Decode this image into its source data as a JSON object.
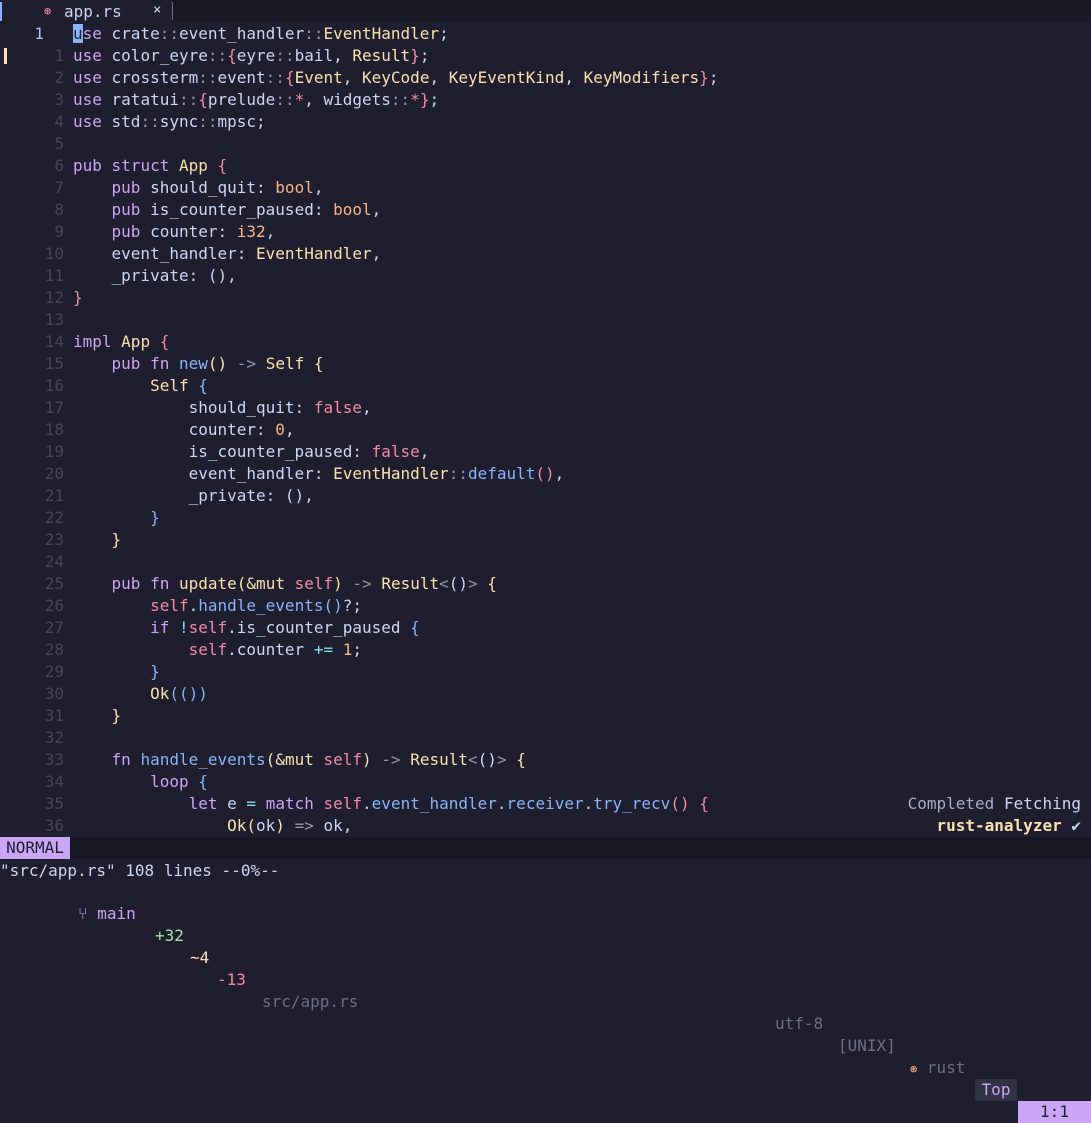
{
  "tab": {
    "file_icon": "rust-icon",
    "filename": "app.rs",
    "close": "×"
  },
  "lines": [
    {
      "num": "1",
      "current": true,
      "sign": false,
      "html": "<span class=\"cursor\">u</span><span class=\"kw\">se</span> crate<span class=\"pu\">::</span>event_handler<span class=\"pu\">::</span><span class=\"ty\">EventHandler</span>;"
    },
    {
      "num": "1",
      "current": false,
      "sign": true,
      "html": "<span class=\"kw\">use</span> color_eyre<span class=\"pu\">::</span><span class=\"br1\">{</span>eyre<span class=\"pu\">::</span>bail, <span class=\"ty\">Result</span><span class=\"br1\">}</span>;"
    },
    {
      "num": "2",
      "current": false,
      "sign": false,
      "html": "<span class=\"kw\">use</span> crossterm<span class=\"pu\">::</span>event<span class=\"pu\">::</span><span class=\"br1\">{</span><span class=\"ty\">Event</span>, <span class=\"ty\">KeyCode</span>, <span class=\"ty\">KeyEventKind</span>, <span class=\"ty\">KeyModifiers</span><span class=\"br1\">}</span>;"
    },
    {
      "num": "3",
      "current": false,
      "sign": false,
      "html": "<span class=\"kw\">use</span> ratatui<span class=\"pu\">::</span><span class=\"br1\">{</span>prelude<span class=\"pu\">::</span><span class=\"br1\">*</span>, widgets<span class=\"pu\">::</span><span class=\"br1\">*</span><span class=\"br1\">}</span>;"
    },
    {
      "num": "4",
      "current": false,
      "sign": false,
      "html": "<span class=\"kw\">use</span> std<span class=\"pu\">::</span>sync<span class=\"pu\">::</span>mpsc;"
    },
    {
      "num": "5",
      "current": false,
      "sign": false,
      "html": ""
    },
    {
      "num": "6",
      "current": false,
      "sign": false,
      "html": "<span class=\"kw\">pub</span> <span class=\"kw\">struct</span> <span class=\"ty\">App</span> <span class=\"br1\">{</span>"
    },
    {
      "num": "7",
      "current": false,
      "sign": false,
      "html": "    <span class=\"kw\">pub</span> should_quit: <span class=\"nu\">bool</span>,"
    },
    {
      "num": "8",
      "current": false,
      "sign": false,
      "html": "    <span class=\"kw\">pub</span> is_counter_paused: <span class=\"nu\">bool</span>,"
    },
    {
      "num": "9",
      "current": false,
      "sign": false,
      "html": "    <span class=\"kw\">pub</span> counter: <span class=\"nu\">i32</span>,"
    },
    {
      "num": "10",
      "current": false,
      "sign": false,
      "html": "    event_handler: <span class=\"ty\">EventHandler</span>,"
    },
    {
      "num": "11",
      "current": false,
      "sign": false,
      "html": "    _private: (),"
    },
    {
      "num": "12",
      "current": false,
      "sign": false,
      "html": "<span class=\"br1\">}</span>"
    },
    {
      "num": "13",
      "current": false,
      "sign": false,
      "html": ""
    },
    {
      "num": "14",
      "current": false,
      "sign": false,
      "html": "<span class=\"kw\">impl</span> <span class=\"ty\">App</span> <span class=\"br1\">{</span>"
    },
    {
      "num": "15",
      "current": false,
      "sign": false,
      "html": "    <span class=\"kw\">pub</span> <span class=\"kw\">fn</span> <span class=\"fn\">new</span><span class=\"br2\">()</span> <span class=\"pu\">-&gt;</span> <span class=\"ty\">Self</span> <span class=\"br2\">{</span>"
    },
    {
      "num": "16",
      "current": false,
      "sign": false,
      "html": "        <span class=\"ty\">Self</span> <span class=\"br3\">{</span>"
    },
    {
      "num": "17",
      "current": false,
      "sign": false,
      "html": "            should_quit: <span class=\"sf\">false</span>,"
    },
    {
      "num": "18",
      "current": false,
      "sign": false,
      "html": "            counter: <span class=\"nu\">0</span>,"
    },
    {
      "num": "19",
      "current": false,
      "sign": false,
      "html": "            is_counter_paused: <span class=\"sf\">false</span>,"
    },
    {
      "num": "20",
      "current": false,
      "sign": false,
      "html": "            event_handler: <span class=\"ty\">EventHandler</span><span class=\"pu\">::</span><span class=\"fn\">default</span><span class=\"br1\">()</span>,"
    },
    {
      "num": "21",
      "current": false,
      "sign": false,
      "html": "            _private: (),"
    },
    {
      "num": "22",
      "current": false,
      "sign": false,
      "html": "        <span class=\"br3\">}</span>"
    },
    {
      "num": "23",
      "current": false,
      "sign": false,
      "html": "    <span class=\"br2\">}</span>"
    },
    {
      "num": "24",
      "current": false,
      "sign": false,
      "html": ""
    },
    {
      "num": "25",
      "current": false,
      "sign": false,
      "html": "    <span class=\"kw\">pub</span> <span class=\"kw\">fn</span> <span class=\"ty\">update</span><span class=\"br2\">(</span><span class=\"ty\">&amp;mut</span> <span class=\"sf\">self</span><span class=\"br2\">)</span> <span class=\"pu\">-&gt;</span> <span class=\"ty\">Result</span><span class=\"pu\">&lt;</span>()<span class=\"pu\">&gt;</span> <span class=\"br2\">{</span>"
    },
    {
      "num": "26",
      "current": false,
      "sign": false,
      "html": "        <span class=\"sf\">self</span>.<span class=\"fn\">handle_events</span><span class=\"br3\">()</span>?;"
    },
    {
      "num": "27",
      "current": false,
      "sign": false,
      "html": "        <span class=\"kw\">if</span> <span class=\"op\">!</span><span class=\"sf\">self</span>.is_counter_paused <span class=\"br3\">{</span>"
    },
    {
      "num": "28",
      "current": false,
      "sign": false,
      "html": "            <span class=\"sf\">self</span>.counter <span class=\"op\">+=</span> <span class=\"nu\">1</span>;"
    },
    {
      "num": "29",
      "current": false,
      "sign": false,
      "html": "        <span class=\"br3\">}</span>"
    },
    {
      "num": "30",
      "current": false,
      "sign": false,
      "html": "        <span class=\"ty\">Ok</span><span class=\"br3\">(())</span>"
    },
    {
      "num": "31",
      "current": false,
      "sign": false,
      "html": "    <span class=\"br2\">}</span>"
    },
    {
      "num": "32",
      "current": false,
      "sign": false,
      "html": ""
    },
    {
      "num": "33",
      "current": false,
      "sign": false,
      "html": "    <span class=\"kw\">fn</span> <span class=\"fn\">handle_events</span><span class=\"br2\">(</span><span class=\"ty\">&amp;mut</span> <span class=\"sf\">self</span><span class=\"br2\">)</span> <span class=\"pu\">-&gt;</span> <span class=\"ty\">Result</span><span class=\"pu\">&lt;</span>()<span class=\"pu\">&gt;</span> <span class=\"br2\">{</span>"
    },
    {
      "num": "34",
      "current": false,
      "sign": false,
      "html": "        <span class=\"kw\">loop</span> <span class=\"br3\">{</span>"
    },
    {
      "num": "35",
      "current": false,
      "sign": false,
      "html": "            <span class=\"kw\">let</span> e <span class=\"op\">=</span> <span class=\"kw\">match</span> <span class=\"sf\">self</span>.<span class=\"fn\">event_handler</span>.<span class=\"fn\">receiver</span>.<span class=\"fn\">try_recv</span><span class=\"br1\">()</span> <span class=\"br1\">{</span>"
    },
    {
      "num": "36",
      "current": false,
      "sign": false,
      "html": "                <span class=\"ty\">Ok</span><span class=\"br2\">(</span>ok<span class=\"br2\">)</span> <span class=\"pu\">=&gt;</span> ok,"
    }
  ],
  "lsp": {
    "status": "Completed",
    "action": "Fetching",
    "server": "rust-analyzer",
    "done": "✔"
  },
  "statusline": {
    "mode": "NORMAL",
    "branch_icon": "git-branch-icon",
    "branch": " main",
    "added": "+32",
    "modified": "~4",
    "removed": "-13",
    "path": "src/app.rs",
    "encoding": "utf-8",
    "fileformat": "[UNIX]",
    "filetype_icon": "rust-icon",
    "filetype": "rust",
    "percent": "Top",
    "linecol": "1:1"
  },
  "cmdline": "\"src/app.rs\" 108 lines --0%--",
  "colors": {
    "background": "#1e1e2e",
    "mode_bg": "#cba6f7",
    "keyword": "#cba6f7",
    "type": "#f9e2af",
    "function": "#89b4fa"
  }
}
